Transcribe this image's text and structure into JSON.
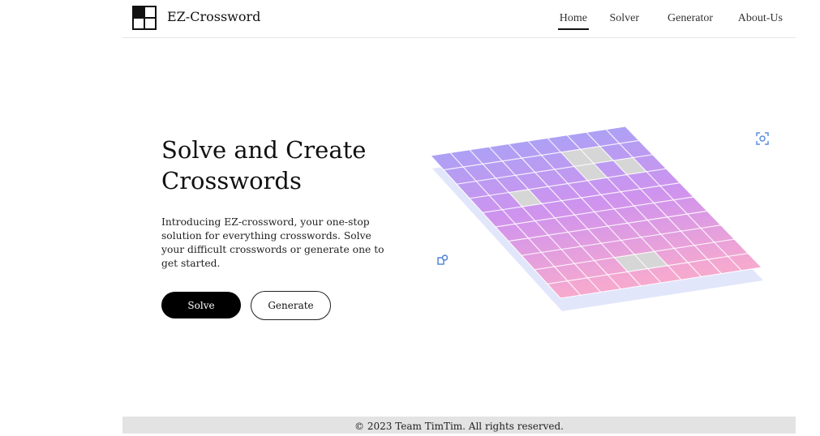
{
  "brand": {
    "name": "EZ-Crossword",
    "logo_icon": "crossword-logo-icon"
  },
  "nav": {
    "items": [
      {
        "label": "Home",
        "active": true
      },
      {
        "label": "Solver",
        "active": false
      },
      {
        "label": "Generator",
        "active": false
      },
      {
        "label": "About-Us",
        "active": false
      }
    ]
  },
  "hero": {
    "title": "Solve and Create Crosswords",
    "description": "Introducing EZ-crossword, your one-stop solution for everything crosswords. Solve your difficult crosswords or generate one to get started.",
    "solve_label": "Solve",
    "generate_label": "Generate"
  },
  "illustration": {
    "grid_rows": 10,
    "grid_cols": 10,
    "gradient_top": "#9fa6f7",
    "gradient_mid": "#cf93ee",
    "gradient_bottom": "#f6a9cf",
    "shadow_color": "#e2e6fb",
    "cell_blank_color": "#d6d6d6",
    "blank_cells": [
      [
        1,
        6
      ],
      [
        1,
        7
      ],
      [
        2,
        6
      ],
      [
        2,
        8
      ],
      [
        3,
        2
      ],
      [
        8,
        4
      ],
      [
        8,
        5
      ]
    ]
  },
  "footer": {
    "text": "© 2023 Team TimTim. All rights reserved."
  },
  "colors": {
    "primary": "#000000",
    "footer_bg": "#e3e3e3"
  }
}
